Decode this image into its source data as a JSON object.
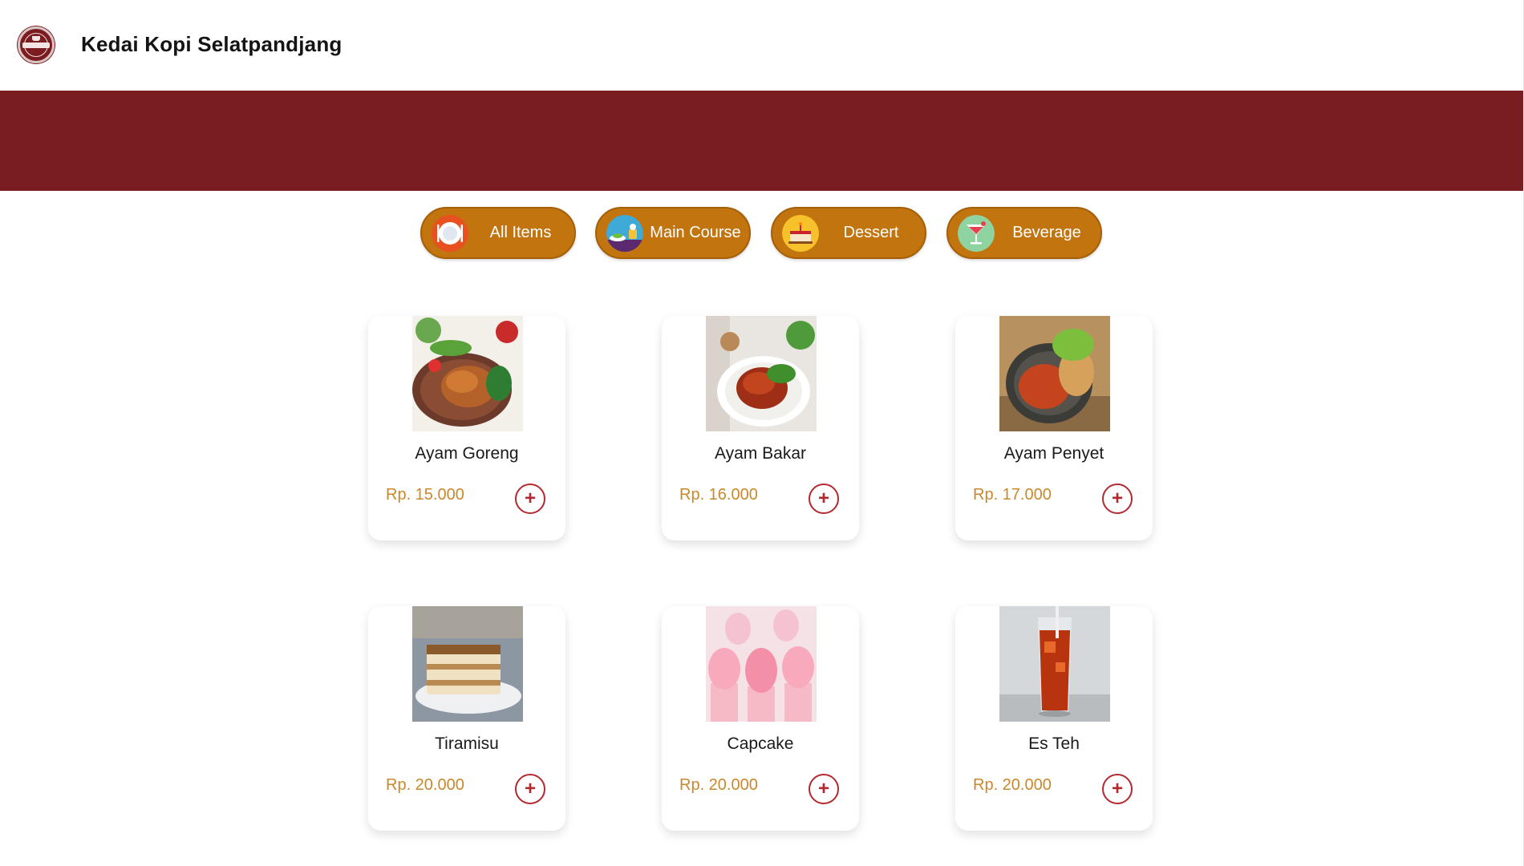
{
  "header": {
    "title": "Kedai Kopi Selatpandjang",
    "logo_icon": "coffee-shop-logo-icon"
  },
  "banner": {
    "color": "#7a1d20"
  },
  "categories": [
    {
      "label": "All Items",
      "icon": "plate-icon"
    },
    {
      "label": "Main Course",
      "icon": "main-course-icon"
    },
    {
      "label": "Dessert",
      "icon": "cake-icon"
    },
    {
      "label": "Beverage",
      "icon": "cocktail-icon"
    }
  ],
  "products": [
    {
      "name": "Ayam Goreng",
      "price": "Rp. 15.000",
      "image": "fried-chicken-photo"
    },
    {
      "name": "Ayam Bakar",
      "price": "Rp. 16.000",
      "image": "grilled-chicken-photo"
    },
    {
      "name": "Ayam Penyet",
      "price": "Rp. 17.000",
      "image": "smashed-chicken-photo"
    },
    {
      "name": "Tiramisu",
      "price": "Rp. 20.000",
      "image": "tiramisu-photo"
    },
    {
      "name": "Capcake",
      "price": "Rp. 20.000",
      "image": "cupcake-photo"
    },
    {
      "name": "Es Teh",
      "price": "Rp. 20.000",
      "image": "iced-tea-photo"
    }
  ],
  "add_button_icon": "plus-circle-icon",
  "colors": {
    "brand": "#7a1d20",
    "pill": "#c2740f",
    "price": "#c9882b",
    "add_button": "#b22a2f"
  }
}
